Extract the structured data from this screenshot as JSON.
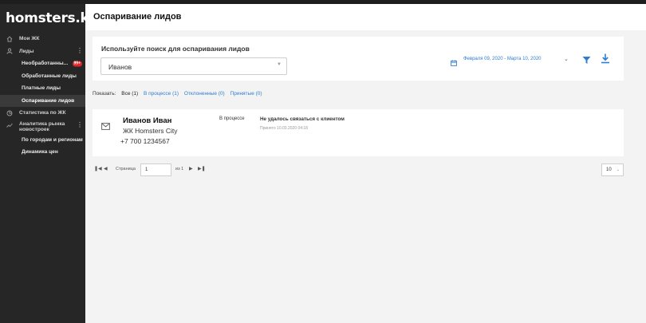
{
  "app": {
    "logo": "homsters.kz"
  },
  "sidebar": {
    "items": [
      {
        "label": "Мои ЖК",
        "icon": "home-icon"
      },
      {
        "label": "Лиды",
        "icon": "user-icon",
        "menu": "⋮"
      },
      {
        "label": "Необработанны...",
        "badge": "99+"
      },
      {
        "label": "Обработанные лиды"
      },
      {
        "label": "Платные лиды"
      },
      {
        "label": "Оспаривание лидов"
      },
      {
        "label": "Статистика по ЖК",
        "icon": "pie-chart-icon"
      },
      {
        "label": "Аналитика рынка новостроек",
        "icon": "trend-chart-icon",
        "menu": "⋮"
      },
      {
        "label": "По городам и регионам"
      },
      {
        "label": "Динамика цен"
      }
    ],
    "active_item": "Оспаривание лидов"
  },
  "header": {
    "title": "Оспаривание лидов"
  },
  "search": {
    "label": "Используйте поиск для оспаривания лидов",
    "value": "Иванов",
    "date_range": "Февраля 09, 2020 - Марта 10, 2020"
  },
  "filters": {
    "show_label": "Показать:",
    "options": [
      {
        "label": "Все (1)",
        "active": true
      },
      {
        "label": "В процессе (1)",
        "active": false
      },
      {
        "label": "Отклоненные (0)",
        "active": false
      },
      {
        "label": "Принятые (0)",
        "active": false
      }
    ]
  },
  "leads": [
    {
      "name": "Иванов Иван",
      "complex": "ЖК Homsters City",
      "phone": "+7 700 1234567",
      "status": "В процессе",
      "reason": "Не удалось связаться с клиентом",
      "date": "Принято 10.03.2020 04:18"
    }
  ],
  "pagination": {
    "page_label": "Страница",
    "page_value": "1",
    "of_label": "из 1",
    "page_size": "10"
  },
  "colors": {
    "accent": "#2d7dd2",
    "sidebar_bg": "#262626",
    "badge": "#e4262c"
  }
}
